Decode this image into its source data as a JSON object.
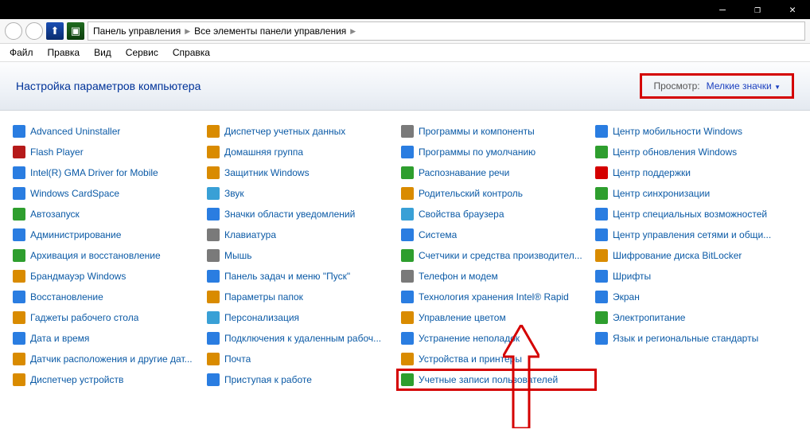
{
  "titlebar": {
    "min": "—",
    "max": "❐",
    "close": "✕"
  },
  "breadcrumb": {
    "root": "Панель управления",
    "sub": "Все элементы панели управления"
  },
  "menu": [
    "Файл",
    "Правка",
    "Вид",
    "Сервис",
    "Справка"
  ],
  "header": {
    "title": "Настройка параметров компьютера",
    "view_label": "Просмотр:",
    "view_value": "Мелкие значки"
  },
  "items": [
    {
      "label": "Advanced Uninstaller",
      "c": "#2a7de1"
    },
    {
      "label": "Flash Player",
      "c": "#b51a1a"
    },
    {
      "label": "Intel(R) GMA Driver for Mobile",
      "c": "#2a7de1"
    },
    {
      "label": "Windows CardSpace",
      "c": "#2a7de1"
    },
    {
      "label": "Автозапуск",
      "c": "#2e9e2e"
    },
    {
      "label": "Администрирование",
      "c": "#2a7de1"
    },
    {
      "label": "Архивация и восстановление",
      "c": "#2e9e2e"
    },
    {
      "label": "Брандмауэр Windows",
      "c": "#d98b00"
    },
    {
      "label": "Восстановление",
      "c": "#2a7de1"
    },
    {
      "label": "Гаджеты рабочего стола",
      "c": "#d98b00"
    },
    {
      "label": "Дата и время",
      "c": "#2a7de1"
    },
    {
      "label": "Датчик расположения и другие дат...",
      "c": "#d98b00"
    },
    {
      "label": "Диспетчер устройств",
      "c": "#d98b00"
    },
    {
      "label": "Диспетчер учетных данных",
      "c": "#d98b00"
    },
    {
      "label": "Домашняя группа",
      "c": "#d98b00"
    },
    {
      "label": "Защитник Windows",
      "c": "#d98b00"
    },
    {
      "label": "Звук",
      "c": "#39a0d6"
    },
    {
      "label": "Значки области уведомлений",
      "c": "#2a7de1"
    },
    {
      "label": "Клавиатура",
      "c": "#7a7a7a"
    },
    {
      "label": "Мышь",
      "c": "#7a7a7a"
    },
    {
      "label": "Панель задач и меню \"Пуск\"",
      "c": "#2a7de1"
    },
    {
      "label": "Параметры папок",
      "c": "#d98b00"
    },
    {
      "label": "Персонализация",
      "c": "#39a0d6"
    },
    {
      "label": "Подключения к удаленным рабоч...",
      "c": "#2a7de1"
    },
    {
      "label": "Почта",
      "c": "#d98b00"
    },
    {
      "label": "Приступая к работе",
      "c": "#2a7de1"
    },
    {
      "label": "Программы и компоненты",
      "c": "#7a7a7a"
    },
    {
      "label": "Программы по умолчанию",
      "c": "#2a7de1"
    },
    {
      "label": "Распознавание речи",
      "c": "#2e9e2e"
    },
    {
      "label": "Родительский контроль",
      "c": "#d98b00"
    },
    {
      "label": "Свойства браузера",
      "c": "#39a0d6"
    },
    {
      "label": "Система",
      "c": "#2a7de1"
    },
    {
      "label": "Счетчики и средства производител...",
      "c": "#2e9e2e"
    },
    {
      "label": "Телефон и модем",
      "c": "#7a7a7a"
    },
    {
      "label": "Технология хранения Intel® Rapid",
      "c": "#2a7de1"
    },
    {
      "label": "Управление цветом",
      "c": "#d98b00"
    },
    {
      "label": "Устранение неполадок",
      "c": "#2a7de1"
    },
    {
      "label": "Устройства и принтеры",
      "c": "#d98b00"
    },
    {
      "label": "Учетные записи пользователей",
      "c": "#2e9e2e",
      "hl": true
    },
    {
      "label": "Центр мобильности Windows",
      "c": "#2a7de1"
    },
    {
      "label": "Центр обновления Windows",
      "c": "#2e9e2e"
    },
    {
      "label": "Центр поддержки",
      "c": "#d40000"
    },
    {
      "label": "Центр синхронизации",
      "c": "#2e9e2e"
    },
    {
      "label": "Центр специальных возможностей",
      "c": "#2a7de1"
    },
    {
      "label": "Центр управления сетями и общи...",
      "c": "#2a7de1"
    },
    {
      "label": "Шифрование диска BitLocker",
      "c": "#d98b00"
    },
    {
      "label": "Шрифты",
      "c": "#2a7de1"
    },
    {
      "label": "Экран",
      "c": "#2a7de1"
    },
    {
      "label": "Электропитание",
      "c": "#2e9e2e"
    },
    {
      "label": "Язык и региональные стандарты",
      "c": "#2a7de1"
    }
  ]
}
